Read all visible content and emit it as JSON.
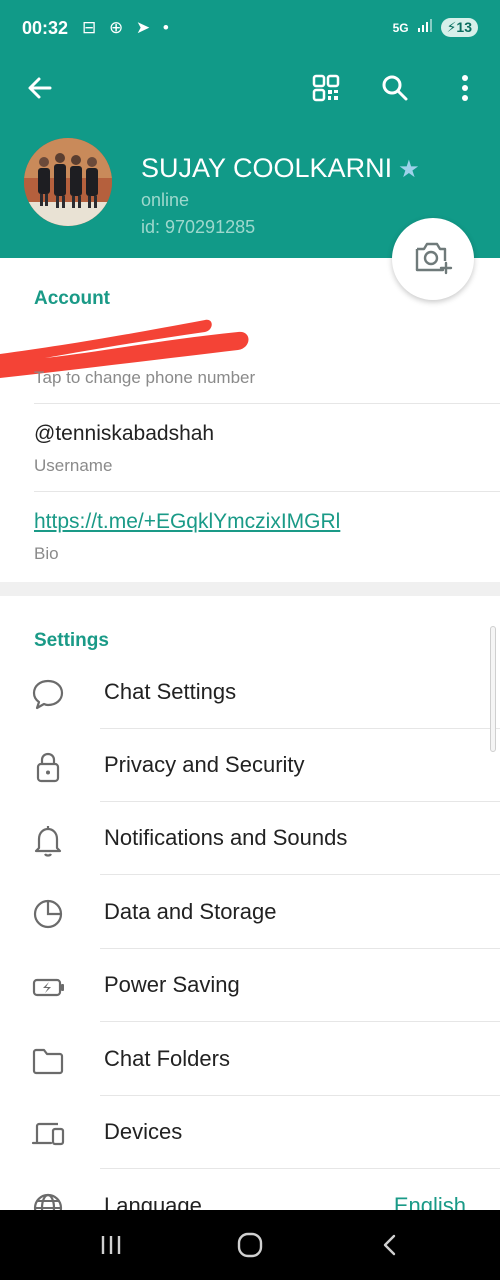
{
  "status": {
    "time": "00:32",
    "left_icons": "⊟ ⊕ ➤ •",
    "network": "5G",
    "battery": "13"
  },
  "icons": {
    "back": "back-arrow-icon",
    "qr": "qr-code-icon",
    "search": "search-icon",
    "more": "more-vertical-icon",
    "camera": "add-photo-icon"
  },
  "profile": {
    "name": "SUJAY COOLKARNI",
    "status": "online",
    "id_text": "id: 970291285"
  },
  "account": {
    "title": "Account",
    "phone_hint": "Tap to change phone number",
    "username": "@tenniskabadshah",
    "username_label": "Username",
    "bio": "https://t.me/+EGqklYmczixIMGRl",
    "bio_label": "Bio"
  },
  "settings": {
    "title": "Settings",
    "items": [
      {
        "label": "Chat Settings",
        "icon": "chat-bubble-icon"
      },
      {
        "label": "Privacy and Security",
        "icon": "lock-icon"
      },
      {
        "label": "Notifications and Sounds",
        "icon": "bell-icon"
      },
      {
        "label": "Data and Storage",
        "icon": "pie-chart-icon"
      },
      {
        "label": "Power Saving",
        "icon": "battery-saver-icon"
      },
      {
        "label": "Chat Folders",
        "icon": "folder-icon"
      },
      {
        "label": "Devices",
        "icon": "devices-icon"
      },
      {
        "label": "Language",
        "icon": "globe-icon",
        "value": "English"
      }
    ]
  },
  "colors": {
    "header": "#119a88",
    "accent": "#1a9a87",
    "scribble": "#f44336"
  }
}
